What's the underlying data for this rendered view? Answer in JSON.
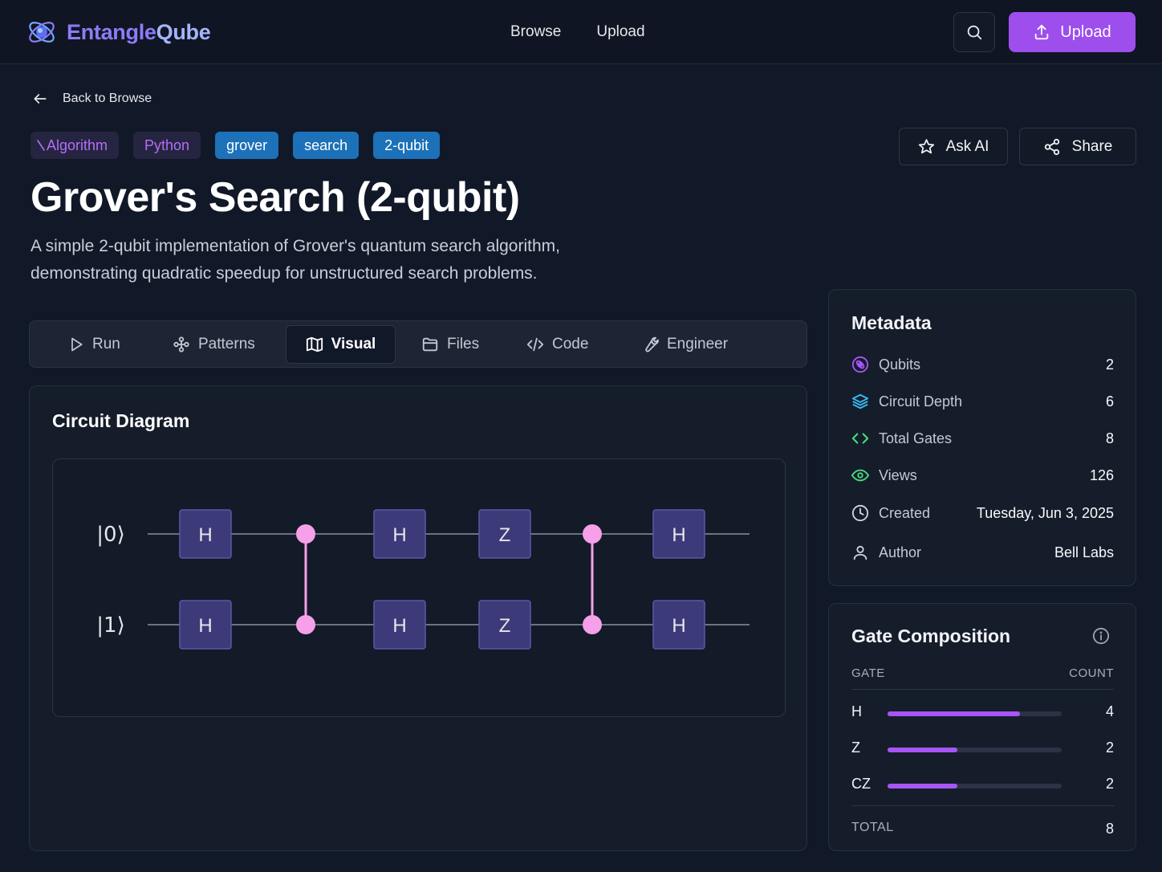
{
  "brand": {
    "name_part1": "Entangle",
    "name_part2": "Qube"
  },
  "nav": {
    "links": [
      {
        "label": "Browse"
      },
      {
        "label": "Upload"
      }
    ],
    "upload_label": "Upload"
  },
  "back_label": "Back to Browse",
  "tags": [
    {
      "label": "Algorithm",
      "style": "purple"
    },
    {
      "label": "Python",
      "style": "purple"
    },
    {
      "label": "grover",
      "style": "blue"
    },
    {
      "label": "search",
      "style": "blue"
    },
    {
      "label": "2-qubit",
      "style": "blue"
    }
  ],
  "actions": {
    "ask_ai": "Ask AI",
    "share": "Share"
  },
  "title": "Grover's Search (2-qubit)",
  "description": "A simple 2-qubit implementation of Grover's quantum search algorithm, demonstrating quadratic speedup for unstructured search problems.",
  "tabs": [
    {
      "label": "Run",
      "icon": "play-icon"
    },
    {
      "label": "Patterns",
      "icon": "patterns-icon"
    },
    {
      "label": "Visual",
      "icon": "map-icon",
      "active": true
    },
    {
      "label": "Files",
      "icon": "folder-icon"
    },
    {
      "label": "Code",
      "icon": "code-icon"
    },
    {
      "label": "Engineer",
      "icon": "wrench-icon"
    }
  ],
  "circuit": {
    "title": "Circuit Diagram",
    "qubits": [
      "|0⟩",
      "|1⟩"
    ],
    "gates": [
      {
        "type": "H",
        "qubit": 0,
        "step": 0
      },
      {
        "type": "H",
        "qubit": 1,
        "step": 0
      },
      {
        "type": "CZ",
        "qubits": [
          0,
          1
        ],
        "step": 1
      },
      {
        "type": "H",
        "qubit": 0,
        "step": 2
      },
      {
        "type": "H",
        "qubit": 1,
        "step": 2
      },
      {
        "type": "Z",
        "qubit": 0,
        "step": 3
      },
      {
        "type": "Z",
        "qubit": 1,
        "step": 3
      },
      {
        "type": "CZ",
        "qubits": [
          0,
          1
        ],
        "step": 4
      },
      {
        "type": "H",
        "qubit": 0,
        "step": 5
      },
      {
        "type": "H",
        "qubit": 1,
        "step": 5
      }
    ]
  },
  "metadata": {
    "title": "Metadata",
    "rows": [
      {
        "label": "Qubits",
        "value": "2",
        "icon": "atom-icon",
        "color": "#a855f7"
      },
      {
        "label": "Circuit Depth",
        "value": "6",
        "icon": "layers-icon",
        "color": "#38bdf8"
      },
      {
        "label": "Total Gates",
        "value": "8",
        "icon": "code-brackets-icon",
        "color": "#4ade80"
      },
      {
        "label": "Views",
        "value": "126",
        "icon": "eye-icon",
        "color": "#4ade80"
      },
      {
        "label": "Created",
        "value": "Tuesday, Jun 3, 2025",
        "icon": "clock-icon",
        "color": "#d1d5db"
      },
      {
        "label": "Author",
        "value": "Bell Labs",
        "icon": "user-icon",
        "color": "#d1d5db"
      }
    ]
  },
  "gate_composition": {
    "title": "Gate Composition",
    "col_gate": "GATE",
    "col_count": "COUNT",
    "rows": [
      {
        "gate": "H",
        "count": "4",
        "fraction": 0.76
      },
      {
        "gate": "Z",
        "count": "2",
        "fraction": 0.4
      },
      {
        "gate": "CZ",
        "count": "2",
        "fraction": 0.4
      }
    ],
    "total_label": "TOTAL",
    "total_value": "8"
  },
  "colors": {
    "accent": "#9d4eed",
    "gate_fill": "#3d3a7a",
    "control": "#f5a0e8",
    "tag_blue": "#1c71b8"
  }
}
